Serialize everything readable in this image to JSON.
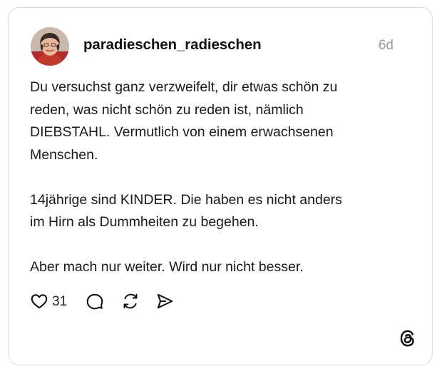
{
  "post": {
    "username": "paradieschen_radieschen",
    "timestamp": "6d",
    "paragraphs": [
      "Du versuchst ganz verzweifelt, dir etwas schön zu\nreden, was nicht schön zu reden ist, nämlich\nDIEBSTAHL. Vermutlich von einem erwachsenen\nMenschen.",
      "14jährige sind KINDER. Die haben es nicht anders\nim Hirn als Dummheiten zu begehen.",
      "Aber mach nur weiter. Wird nur nicht besser."
    ],
    "like_count": "31"
  },
  "icons": {
    "like": "heart-icon",
    "comment": "comment-icon",
    "repost": "repost-icon",
    "share": "share-icon",
    "brand": "threads-logo-icon"
  },
  "colors": {
    "text": "#111111",
    "muted": "#999999",
    "border": "#dcdcdc",
    "background": "#ffffff"
  }
}
